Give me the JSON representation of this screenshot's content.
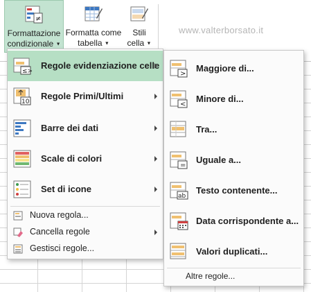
{
  "ribbon": {
    "conditional_formatting": {
      "line1": "Formattazione",
      "line2": "condizionale"
    },
    "format_as_table": {
      "line1": "Formatta come",
      "line2": "tabella"
    },
    "cell_styles": {
      "line1": "Stili",
      "line2": "cella"
    }
  },
  "watermark": "www.valterborsato.it",
  "main_menu": {
    "items": [
      {
        "label": "Regole evidenziazione celle"
      },
      {
        "label": "Regole Primi/Ultimi"
      },
      {
        "label": "Barre dei dati"
      },
      {
        "label": "Scale di colori"
      },
      {
        "label": "Set di icone"
      },
      {
        "label": "Nuova regola..."
      },
      {
        "label": "Cancella regole"
      },
      {
        "label": "Gestisci regole..."
      }
    ]
  },
  "submenu": {
    "items": [
      {
        "label": "Maggiore di..."
      },
      {
        "label": "Minore di..."
      },
      {
        "label": "Tra..."
      },
      {
        "label": "Uguale a..."
      },
      {
        "label": "Testo contenente..."
      },
      {
        "label": "Data corrispondente a..."
      },
      {
        "label": "Valori duplicati..."
      }
    ],
    "more_rules": "Altre regole..."
  },
  "colors": {
    "accent_green": "#b6dfc4",
    "ribbon_active": "#c3e3d1",
    "icon_blue": "#3d78c1",
    "icon_orange": "#f0c070"
  }
}
